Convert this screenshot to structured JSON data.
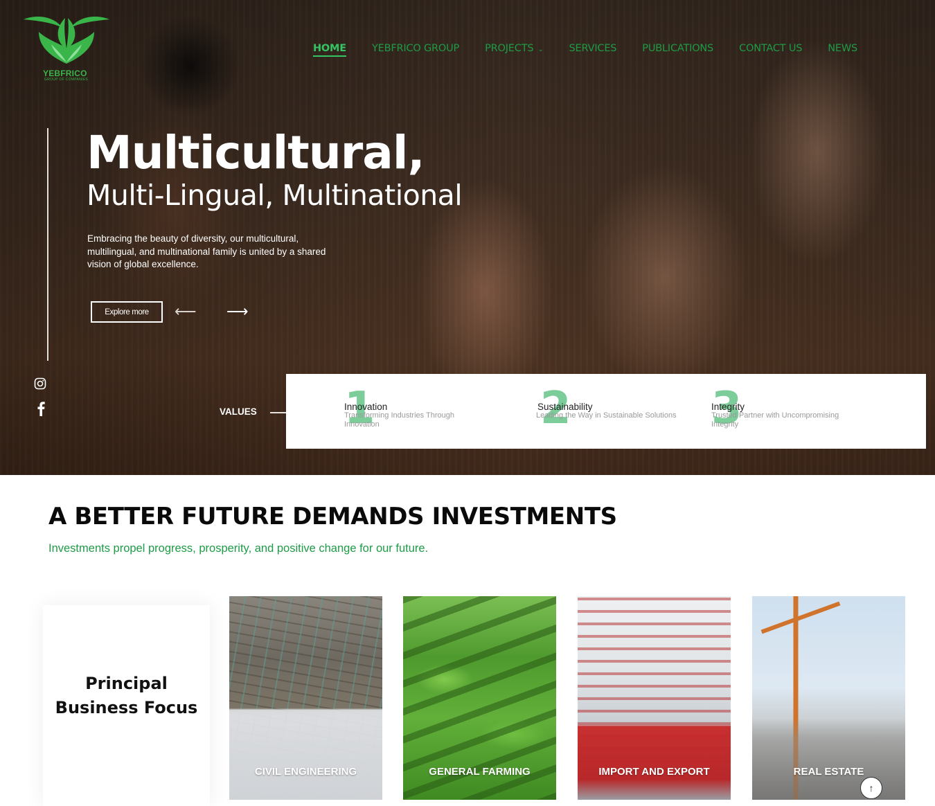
{
  "brand": {
    "name": "YEBFRICO",
    "tagline": "GROUP OF COMPANIES",
    "color": "#39b54a"
  },
  "nav": {
    "items": [
      {
        "label": "HOME",
        "active": true
      },
      {
        "label": "YEBFRICO GROUP"
      },
      {
        "label": "PROJECTS",
        "has_dropdown": true
      },
      {
        "label": "SERVICES"
      },
      {
        "label": "PUBLICATIONS"
      },
      {
        "label": "CONTACT US"
      },
      {
        "label": "NEWS"
      }
    ]
  },
  "hero": {
    "title": "Multicultural,",
    "subtitle": "Multi-Lingual, Multinational",
    "description": "Embracing the beauty of diversity, our multicultural, multilingual, and multinational family is united by a shared vision of global excellence.",
    "button_label": "Explore more",
    "prev_icon": "arrow-left-icon",
    "next_icon": "arrow-right-icon"
  },
  "social": {
    "icons": [
      "instagram-icon",
      "facebook-icon"
    ]
  },
  "values": {
    "label": "VALUES",
    "items": [
      {
        "number": "1",
        "title": "Innovation",
        "subtitle": "Transforming Industries Through Innovation"
      },
      {
        "number": "2",
        "title": "Sustainability",
        "subtitle": "Leading the Way in Sustainable Solutions"
      },
      {
        "number": "3",
        "title": "Integrity",
        "subtitle": "Trusted Partner with Uncompromising Integrity"
      }
    ]
  },
  "section": {
    "title": "A BETTER FUTURE DEMANDS INVESTMENTS",
    "subtitle": "Investments propel progress, prosperity, and positive change for our future.",
    "focus_title": "Principal Business Focus",
    "tiles": [
      {
        "label": "CIVIL ENGINEERING"
      },
      {
        "label": "GENERAL FARMING"
      },
      {
        "label": "IMPORT AND EXPORT"
      },
      {
        "label": "REAL ESTATE"
      }
    ]
  },
  "scroll_top_icon": "arrow-up-icon",
  "colors": {
    "accent": "#1e9b46",
    "active_nav": "#35c464",
    "value_number": "#7ccd9a"
  }
}
